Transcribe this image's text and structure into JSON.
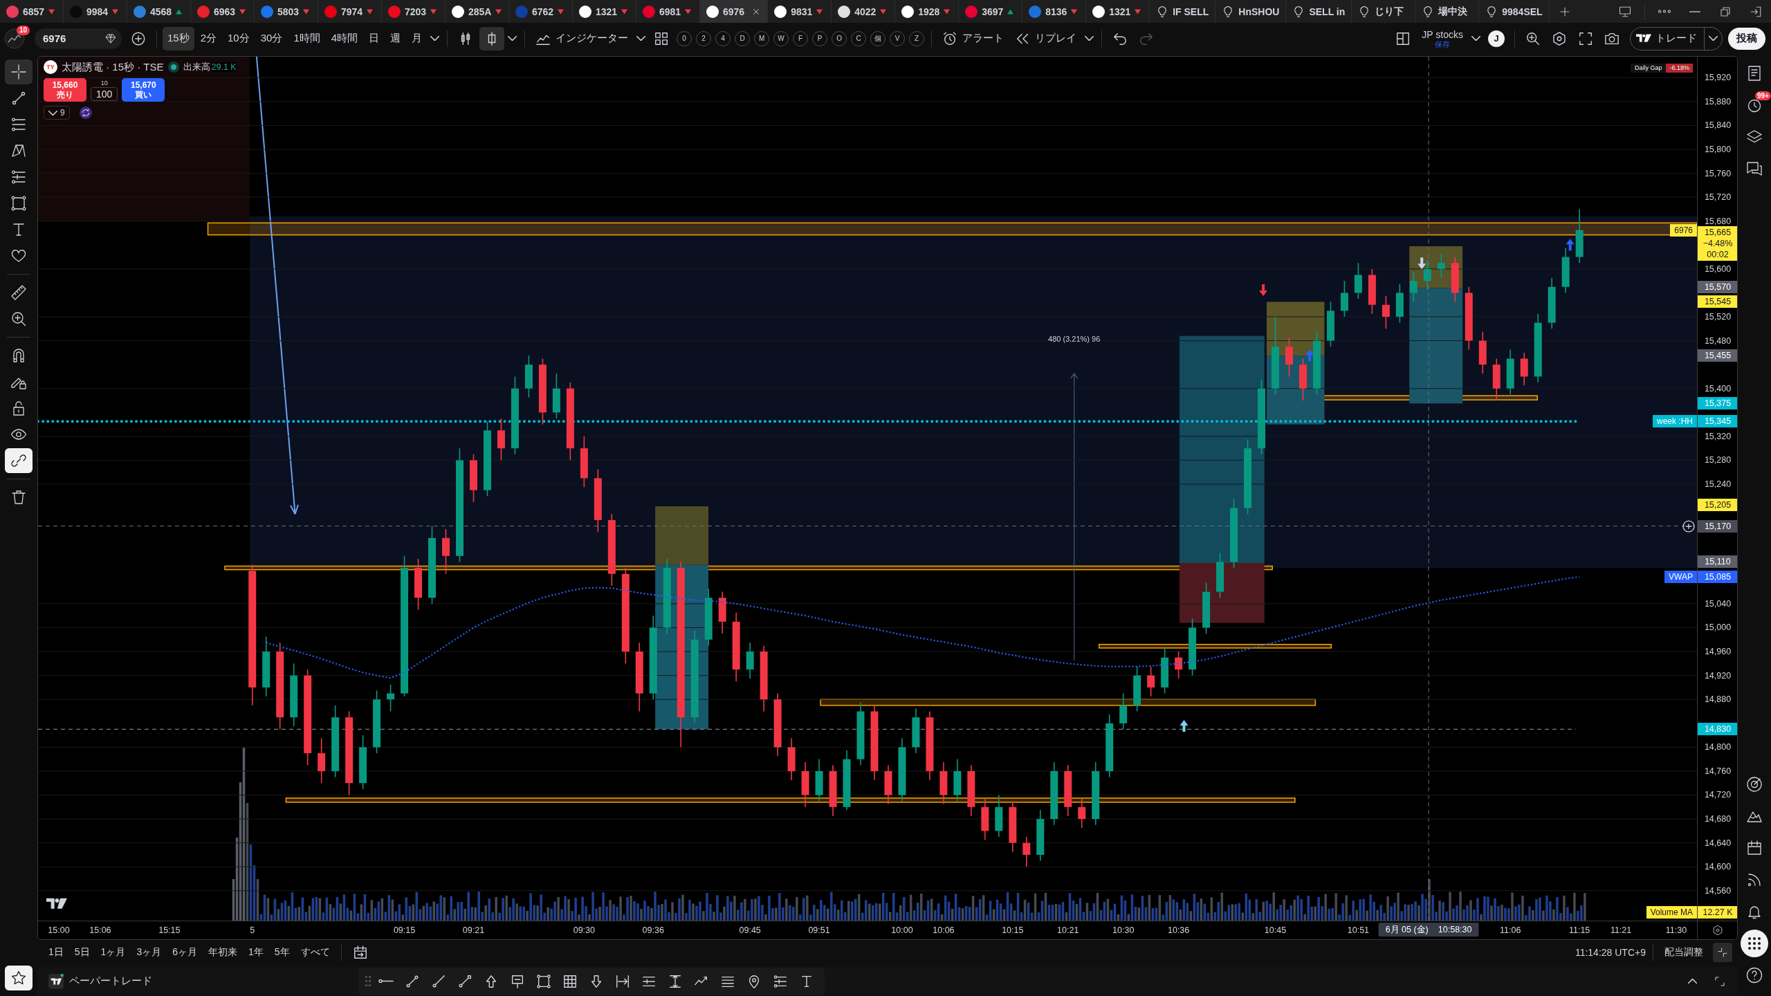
{
  "tabs": [
    {
      "kind": "symbol",
      "label": "6857",
      "color": "#e63c5a",
      "rising": false,
      "selected": false
    },
    {
      "kind": "symbol",
      "label": "9984",
      "color": "#0a0a0a",
      "rising": false,
      "selected": false
    },
    {
      "kind": "symbol",
      "label": "4568",
      "color": "#2a7fd4",
      "rising": true,
      "selected": false
    },
    {
      "kind": "symbol",
      "label": "6963",
      "color": "#e8202a",
      "rising": false,
      "selected": false
    },
    {
      "kind": "symbol",
      "label": "5803",
      "color": "#1a73e8",
      "rising": false,
      "selected": false
    },
    {
      "kind": "symbol",
      "label": "7974",
      "color": "#e60012",
      "rising": false,
      "selected": false
    },
    {
      "kind": "symbol",
      "label": "7203",
      "color": "#eb0a1e",
      "rising": false,
      "selected": false
    },
    {
      "kind": "symbol",
      "label": "285A",
      "color": "#ffffff",
      "rising": false,
      "selected": false
    },
    {
      "kind": "symbol",
      "label": "6762",
      "color": "#1040a0",
      "rising": false,
      "selected": false
    },
    {
      "kind": "symbol",
      "label": "1321",
      "color": "#ffffff",
      "rising": false,
      "selected": false
    },
    {
      "kind": "symbol",
      "label": "6981",
      "color": "#e4002b",
      "rising": false,
      "selected": false
    },
    {
      "kind": "symbol",
      "label": "6976",
      "color": "#ffffff",
      "selected": true
    },
    {
      "kind": "symbol",
      "label": "9831",
      "color": "#ffffff",
      "rising": false,
      "selected": false
    },
    {
      "kind": "symbol",
      "label": "4022",
      "color": "#e0e0e0",
      "rising": false,
      "selected": false
    },
    {
      "kind": "symbol",
      "label": "1928",
      "color": "#ffffff",
      "rising": false,
      "selected": false
    },
    {
      "kind": "symbol",
      "label": "3697",
      "color": "#e60033",
      "rising": true,
      "selected": false
    },
    {
      "kind": "symbol",
      "label": "8136",
      "color": "#1e6fd9",
      "rising": false,
      "selected": false
    },
    {
      "kind": "symbol",
      "label": "1321",
      "color": "#ffffff",
      "rising": false,
      "selected": false
    },
    {
      "kind": "idea",
      "label": "IF SELL",
      "selected": false
    },
    {
      "kind": "idea",
      "label": "HnSHOU",
      "selected": false
    },
    {
      "kind": "idea",
      "label": "SELL in",
      "selected": false
    },
    {
      "kind": "idea",
      "label": "じり下",
      "selected": false
    },
    {
      "kind": "idea",
      "label": "場中決",
      "selected": false
    },
    {
      "kind": "idea",
      "label": "9984SEL",
      "selected": false
    }
  ],
  "toolbar": {
    "notifications": "10",
    "symbol": "6976",
    "intervals": [
      {
        "label": "15秒",
        "selected": true
      },
      {
        "label": "2分",
        "selected": false
      },
      {
        "label": "10分",
        "selected": false
      },
      {
        "label": "30分",
        "selected": false
      },
      {
        "label": "1時間",
        "selected": false
      },
      {
        "label": "4時間",
        "selected": false
      },
      {
        "label": "日",
        "selected": false
      },
      {
        "label": "週",
        "selected": false
      },
      {
        "label": "月",
        "selected": false
      }
    ],
    "chart_styles": [
      {
        "kind": "candles",
        "selected": false
      },
      {
        "kind": "hollow-candle",
        "selected": true
      }
    ],
    "indicators": "インジケーター",
    "quick_buttons": [
      "0",
      "2",
      "4",
      "D",
      "M",
      "W",
      "F",
      "P",
      "O",
      "C",
      "個",
      "V",
      "Z"
    ],
    "alert": "アラート",
    "replay": "リプレイ",
    "history": [
      {
        "kind": "undo",
        "disabled": false
      },
      {
        "kind": "redo",
        "disabled": true
      }
    ],
    "layout_name": "JP stocks",
    "layout_status": "保存",
    "user_initial": "J",
    "trade": "トレード",
    "publish": "投稿"
  },
  "left_toolbar": {
    "tools": [
      {
        "kind": "crosshair",
        "selected": true
      },
      {
        "kind": "trend-line",
        "selected": false
      },
      {
        "kind": "fib",
        "selected": false
      },
      {
        "kind": "pattern",
        "selected": false
      },
      {
        "kind": "channel",
        "selected": false
      },
      {
        "kind": "rectangle",
        "selected": false
      },
      {
        "kind": "text",
        "selected": false
      },
      {
        "kind": "heart",
        "selected": false
      },
      {
        "kind": "ruler",
        "selected": false
      },
      {
        "kind": "zoom",
        "selected": false
      }
    ],
    "toggles": [
      {
        "kind": "magnet",
        "on": false
      },
      {
        "kind": "drawing-lock",
        "on": false
      },
      {
        "kind": "lock",
        "on": false
      },
      {
        "kind": "eye",
        "on": false
      },
      {
        "kind": "link",
        "on": true
      }
    ]
  },
  "legend": {
    "logo": "TY",
    "title": "太陽誘電 · 15秒 · TSE",
    "volume_label": "出来高",
    "volume": "29.1 K",
    "sell_price": "15,660",
    "sell_label": "売り",
    "qty_step": "10",
    "qty": "100",
    "buy_price": "15,670",
    "buy_label": "買い",
    "indicator_count": "9"
  },
  "daily_gap": {
    "label": "Daily Gap",
    "value": "-6.18%"
  },
  "chart": {
    "chart_data": [
      {
        "type": "candlestick",
        "categories": [
          null,
          "15:00",
          null,
          null,
          "15:06",
          null,
          null,
          null,
          null,
          "15:15",
          null,
          null,
          null,
          null,
          null,
          "5",
          null,
          null,
          null,
          null,
          null,
          null,
          null,
          null,
          null,
          null,
          "09:15",
          null,
          null,
          null,
          null,
          "09:21",
          null,
          null,
          null,
          null,
          null,
          null,
          null,
          "09:30",
          null,
          null,
          null,
          null,
          "09:36",
          null,
          null,
          null,
          null,
          null,
          null,
          "09:45",
          null,
          null,
          null,
          null,
          "09:51",
          null,
          null,
          null,
          null,
          null,
          "10:00",
          null,
          null,
          "10:06",
          null,
          null,
          null,
          null,
          "10:15",
          null,
          null,
          null,
          "10:21",
          null,
          null,
          null,
          "10:30",
          null,
          null,
          null,
          "10:36",
          null,
          null,
          null,
          null,
          null,
          null,
          "10:45",
          null,
          null,
          null,
          null,
          null,
          "10:51",
          null,
          null,
          null,
          null,
          null,
          null,
          null,
          null,
          null,
          null,
          "11:06",
          null,
          null,
          null,
          null,
          "11:15",
          null,
          null,
          "11:21",
          null,
          null,
          null,
          "11:30",
          null
        ],
        "ohlc": [
          null,
          null,
          null,
          null,
          null,
          null,
          null,
          null,
          null,
          null,
          null,
          null,
          null,
          null,
          null,
          [
            15095,
            15105,
            14870,
            14900
          ],
          [
            14900,
            14985,
            14885,
            14960
          ],
          [
            14960,
            14975,
            14830,
            14850
          ],
          [
            14850,
            14940,
            14835,
            14920
          ],
          [
            14920,
            14930,
            14770,
            14790
          ],
          [
            14790,
            14815,
            14740,
            14760
          ],
          [
            14760,
            14870,
            14750,
            14850
          ],
          [
            14850,
            14860,
            14720,
            14740
          ],
          [
            14740,
            14820,
            14730,
            14800
          ],
          [
            14800,
            14895,
            14790,
            14880
          ],
          [
            14880,
            14905,
            14860,
            14890
          ],
          [
            14890,
            15120,
            14885,
            15100
          ],
          [
            15100,
            15115,
            15030,
            15050
          ],
          [
            15050,
            15170,
            15040,
            15150
          ],
          [
            15150,
            15165,
            15090,
            15120
          ],
          [
            15120,
            15300,
            15110,
            15280
          ],
          [
            15280,
            15290,
            15210,
            15230
          ],
          [
            15230,
            15345,
            15220,
            15330
          ],
          [
            15330,
            15350,
            15280,
            15300
          ],
          [
            15300,
            15420,
            15290,
            15400
          ],
          [
            15400,
            15455,
            15385,
            15440
          ],
          [
            15440,
            15450,
            15340,
            15360
          ],
          [
            15360,
            15425,
            15350,
            15400
          ],
          [
            15400,
            15410,
            15280,
            15300
          ],
          [
            15300,
            15320,
            15235,
            15250
          ],
          [
            15250,
            15265,
            15160,
            15180
          ],
          [
            15180,
            15190,
            15070,
            15090
          ],
          [
            15090,
            15100,
            14940,
            14960
          ],
          [
            14960,
            14975,
            14860,
            14890
          ],
          [
            14890,
            15020,
            14880,
            15000
          ],
          [
            15000,
            15115,
            14990,
            15100
          ],
          [
            15100,
            15110,
            14800,
            14850
          ],
          [
            14850,
            14995,
            14840,
            14980
          ],
          [
            14980,
            15065,
            14970,
            15050
          ],
          [
            15050,
            15060,
            14990,
            15010
          ],
          [
            15010,
            15025,
            14910,
            14930
          ],
          [
            14930,
            14975,
            14915,
            14960
          ],
          [
            14960,
            14970,
            14860,
            14880
          ],
          [
            14880,
            14890,
            14785,
            14800
          ],
          [
            14800,
            14815,
            14745,
            14760
          ],
          [
            14760,
            14775,
            14700,
            14720
          ],
          [
            14720,
            14780,
            14710,
            14760
          ],
          [
            14760,
            14770,
            14685,
            14700
          ],
          [
            14700,
            14795,
            14695,
            14780
          ],
          [
            14780,
            14875,
            14770,
            14860
          ],
          [
            14860,
            14870,
            14745,
            14760
          ],
          [
            14760,
            14770,
            14705,
            14720
          ],
          [
            14720,
            14815,
            14710,
            14800
          ],
          [
            14800,
            14865,
            14790,
            14850
          ],
          [
            14850,
            14860,
            14745,
            14760
          ],
          [
            14760,
            14775,
            14705,
            14720
          ],
          [
            14720,
            14780,
            14710,
            14760
          ],
          [
            14760,
            14770,
            14685,
            14700
          ],
          [
            14700,
            14715,
            14645,
            14660
          ],
          [
            14660,
            14720,
            14650,
            14700
          ],
          [
            14700,
            14710,
            14625,
            14640
          ],
          [
            14640,
            14650,
            14600,
            14620
          ],
          [
            14620,
            14695,
            14610,
            14680
          ],
          [
            14680,
            14775,
            14670,
            14760
          ],
          [
            14760,
            14770,
            14685,
            14700
          ],
          [
            14700,
            14715,
            14665,
            14680
          ],
          [
            14680,
            14775,
            14670,
            14760
          ],
          [
            14760,
            14855,
            14750,
            14840
          ],
          [
            14840,
            14890,
            14830,
            14870
          ],
          [
            14870,
            14935,
            14860,
            14920
          ],
          [
            14920,
            14935,
            14885,
            14900
          ],
          [
            14900,
            14965,
            14890,
            14950
          ],
          [
            14950,
            14960,
            14915,
            14930
          ],
          [
            14930,
            15015,
            14920,
            15000
          ],
          [
            15000,
            15075,
            14990,
            15060
          ],
          [
            15060,
            15125,
            15050,
            15110
          ],
          [
            15110,
            15215,
            15100,
            15200
          ],
          [
            15200,
            15315,
            15190,
            15300
          ],
          [
            15300,
            15415,
            15290,
            15400
          ],
          [
            15400,
            15520,
            15390,
            15470
          ],
          [
            15470,
            15485,
            15420,
            15440
          ],
          [
            15440,
            15450,
            15380,
            15400
          ],
          [
            15400,
            15495,
            15390,
            15480
          ],
          [
            15480,
            15545,
            15470,
            15530
          ],
          [
            15530,
            15580,
            15520,
            15560
          ],
          [
            15560,
            15610,
            15550,
            15590
          ],
          [
            15590,
            15600,
            15525,
            15540
          ],
          [
            15540,
            15555,
            15500,
            15520
          ],
          [
            15520,
            15575,
            15510,
            15560
          ],
          [
            15560,
            15595,
            15545,
            15580
          ],
          [
            15580,
            15615,
            15565,
            15600
          ],
          [
            15600,
            15625,
            15585,
            15610
          ],
          [
            15610,
            15620,
            15545,
            15560
          ],
          [
            15560,
            15570,
            15465,
            15480
          ],
          [
            15480,
            15495,
            15425,
            15440
          ],
          [
            15440,
            15450,
            15380,
            15400
          ],
          [
            15400,
            15465,
            15390,
            15450
          ],
          [
            15450,
            15460,
            15405,
            15420
          ],
          [
            15420,
            15525,
            15410,
            15510
          ],
          [
            15510,
            15585,
            15500,
            15570
          ],
          [
            15570,
            15635,
            15560,
            15620
          ],
          [
            15620,
            15700,
            15610,
            15665
          ],
          null,
          null,
          null,
          null,
          null,
          null,
          null,
          null
        ],
        "series": [
          {
            "name": "VWAP",
            "type": "line",
            "color": "#2962ff",
            "line_style": "dotted",
            "values": [
              null,
              null,
              null,
              null,
              null,
              null,
              null,
              null,
              null,
              null,
              null,
              null,
              null,
              null,
              null,
              null,
              14975,
              14968,
              14962,
              14955,
              14948,
              14940,
              14932,
              14925,
              14920,
              14916,
              14925,
              14940,
              14955,
              14970,
              14985,
              15000,
              15012,
              15022,
              15032,
              15042,
              15050,
              15056,
              15062,
              15066,
              15067,
              15066,
              15062,
              15058,
              15055,
              15052,
              15048,
              15046,
              15045,
              15043,
              15040,
              15036,
              15032,
              15028,
              15024,
              15020,
              15015,
              15010,
              15006,
              15002,
              14998,
              14993,
              14988,
              14984,
              14980,
              14976,
              14972,
              14968,
              14963,
              14958,
              14954,
              14950,
              14946,
              14943,
              14940,
              14938,
              14936,
              14935,
              14935,
              14935,
              14936,
              14938,
              14940,
              14943,
              14947,
              14952,
              14958,
              14964,
              14970,
              14976,
              14982,
              14988,
              14994,
              15000,
              15006,
              15012,
              15018,
              15024,
              15030,
              15036,
              15041,
              15046,
              15050,
              15054,
              15058,
              15062,
              15066,
              15070,
              15074,
              15078,
              15082,
              15085,
              null,
              null,
              null,
              null,
              null,
              null,
              null,
              null
            ]
          }
        ],
        "ylim": [
          14510,
          15955
        ],
        "yticks": [
          {
            "value": 15920,
            "label": "15,920"
          },
          {
            "value": 15880,
            "label": "15,880"
          },
          {
            "value": 15840,
            "label": "15,840"
          },
          {
            "value": 15800,
            "label": "15,800"
          },
          {
            "value": 15760,
            "label": "15,760"
          },
          {
            "value": 15720,
            "label": "15,720"
          },
          {
            "value": 15680,
            "label": "15,680"
          },
          {
            "value": 15600,
            "label": "15,600"
          },
          {
            "value": 15520,
            "label": "15,520"
          },
          {
            "value": 15480,
            "label": "15,480"
          },
          {
            "value": 15400,
            "label": "15,400"
          },
          {
            "value": 15320,
            "label": "15,320"
          },
          {
            "value": 15280,
            "label": "15,280"
          },
          {
            "value": 15240,
            "label": "15,240"
          },
          {
            "value": 15040,
            "label": "15,040"
          },
          {
            "value": 15000,
            "label": "15,000"
          },
          {
            "value": 14960,
            "label": "14,960"
          },
          {
            "value": 14920,
            "label": "14,920"
          },
          {
            "value": 14880,
            "label": "14,880"
          },
          {
            "value": 14800,
            "label": "14,800"
          },
          {
            "value": 14760,
            "label": "14,760"
          },
          {
            "value": 14720,
            "label": "14,720"
          },
          {
            "value": 14680,
            "label": "14,680"
          },
          {
            "value": 14640,
            "label": "14,640"
          },
          {
            "value": 14600,
            "label": "14,600"
          },
          {
            "value": 14560,
            "label": "14,560"
          }
        ],
        "grid": true,
        "ref_lines": [
          {
            "axis": "y",
            "value": 15345,
            "color": "#00bcd4",
            "line_style": "dotted"
          },
          {
            "axis": "y",
            "value": 14830,
            "color": "#787b86",
            "line_style": "dashed"
          }
        ],
        "annotations": [
          "480 (3.21%) 96"
        ]
      }
    ]
  },
  "price_axis": {
    "badges": [
      {
        "text": "15,665",
        "sub": [
          "−4.48%",
          "00:02"
        ],
        "tag": "6976",
        "color": "#ffeb3b"
      },
      {
        "text": "15,570",
        "color": "#5d606b"
      },
      {
        "text": "15,545",
        "color": "#ffeb3b"
      },
      {
        "text": "15,455",
        "color": "#5d606b"
      },
      {
        "text": "15,375",
        "color": "#00bcd4"
      },
      {
        "text": "15,345",
        "tag": "week :HH",
        "color": "#00bcd4"
      },
      {
        "text": "15,205",
        "color": "#ffeb3b"
      },
      {
        "text": "15,110",
        "color": "#5d606b"
      },
      {
        "text": "15,085",
        "color": "#2962ff"
      },
      {
        "text": "14,830",
        "color": "#00bcd4"
      }
    ],
    "volume_ma": {
      "label": "Volume MA",
      "value": "12.27 K"
    }
  },
  "crosshair": {
    "date": "6月 05 (金)",
    "time": "10:58:30",
    "price": "15,170"
  },
  "right_toolbar": [
    {
      "kind": "watchlist",
      "selected": false
    },
    {
      "kind": "alerts",
      "badge": "99+",
      "selected": false
    },
    {
      "kind": "layers",
      "selected": false
    },
    {
      "kind": "chat",
      "selected": false
    },
    {
      "kind": "target",
      "selected": false
    },
    {
      "kind": "ideas",
      "selected": false
    },
    {
      "kind": "calendar",
      "selected": false
    },
    {
      "kind": "news",
      "selected": false
    },
    {
      "kind": "notifications",
      "selected": false
    },
    {
      "kind": "apps",
      "selected": true
    },
    {
      "kind": "help",
      "selected": false
    }
  ],
  "range_bar": {
    "ranges": [
      "1日",
      "5日",
      "1ヶ月",
      "3ヶ月",
      "6ヶ月",
      "年初来",
      "1年",
      "5年",
      "すべて"
    ],
    "clock": "11:14:28 UTC+9",
    "adjustment": "配当調整"
  },
  "bottom_panel": {
    "title": "ペーパートレード"
  }
}
